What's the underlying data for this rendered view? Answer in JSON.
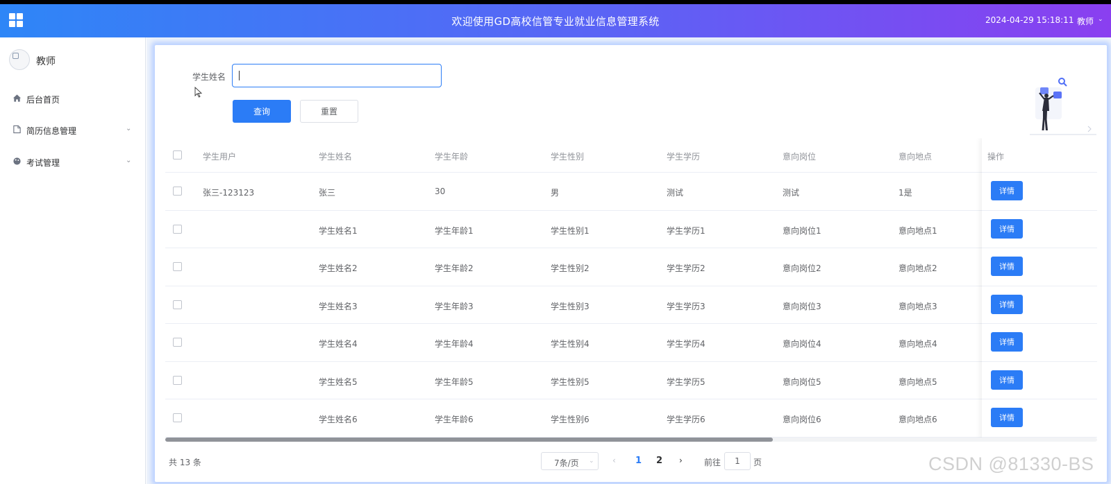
{
  "header": {
    "title": "欢迎使用GD高校信管专业就业信息管理系统",
    "datetime": "2024-04-29 15:18:11",
    "user": "教师",
    "user_caret": "⌄"
  },
  "sidebar": {
    "role": "教师",
    "items": [
      {
        "label": "后台首页",
        "icon": "home-icon",
        "caret": ""
      },
      {
        "label": "简历信息管理",
        "icon": "document-icon",
        "caret": "⌄"
      },
      {
        "label": "考试管理",
        "icon": "palette-icon",
        "caret": "⌄"
      }
    ]
  },
  "search": {
    "label": "学生姓名",
    "value": "",
    "placeholder": "",
    "query_label": "查询",
    "reset_label": "重置"
  },
  "table": {
    "columns": [
      "学生用户",
      "学生姓名",
      "学生年龄",
      "学生性别",
      "学生学历",
      "意向岗位",
      "意向地点"
    ],
    "action_header": "操作",
    "action_label": "详情",
    "rows": [
      [
        "张三-123123",
        "张三",
        "30",
        "男",
        "测试",
        "测试",
        "1是"
      ],
      [
        "",
        "学生姓名1",
        "学生年龄1",
        "学生性别1",
        "学生学历1",
        "意向岗位1",
        "意向地点1"
      ],
      [
        "",
        "学生姓名2",
        "学生年龄2",
        "学生性别2",
        "学生学历2",
        "意向岗位2",
        "意向地点2"
      ],
      [
        "",
        "学生姓名3",
        "学生年龄3",
        "学生性别3",
        "学生学历3",
        "意向岗位3",
        "意向地点3"
      ],
      [
        "",
        "学生姓名4",
        "学生年龄4",
        "学生性别4",
        "学生学历4",
        "意向岗位4",
        "意向地点4"
      ],
      [
        "",
        "学生姓名5",
        "学生年龄5",
        "学生性别5",
        "学生学历5",
        "意向岗位5",
        "意向地点5"
      ],
      [
        "",
        "学生姓名6",
        "学生年龄6",
        "学生性别6",
        "学生学历6",
        "意向岗位6",
        "意向地点6"
      ]
    ]
  },
  "pagination": {
    "total": "共 13 条",
    "page_size": "7条/页",
    "pages": [
      "1",
      "2"
    ],
    "current_page": "1",
    "goto_label": "前往",
    "goto_value": "1",
    "goto_suffix": "页",
    "prev": "‹",
    "next": "›",
    "dropdown_caret": "⌄"
  },
  "watermark": "CSDN @81330-BS",
  "colors": {
    "primary": "#2b7cf6",
    "header_start": "#2e86f7",
    "header_end": "#8a3ff0",
    "panel_glow": "#bcd2ff"
  }
}
